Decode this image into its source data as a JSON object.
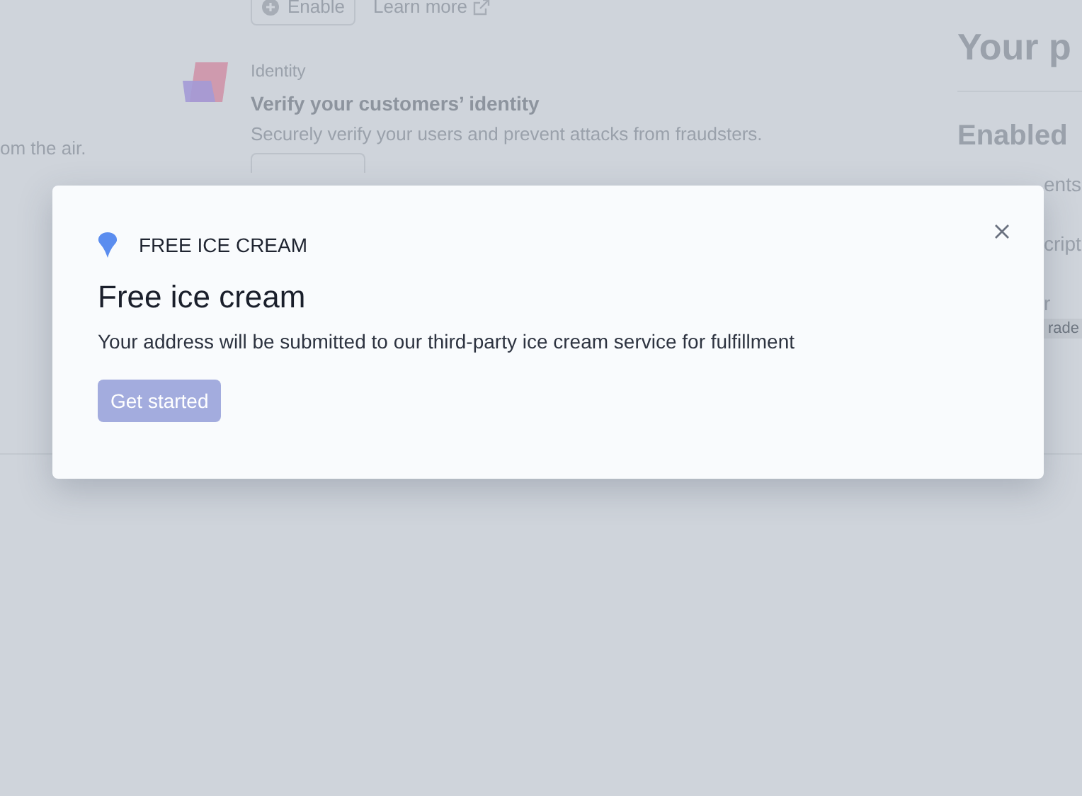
{
  "page": {
    "left_text": "om the air.",
    "enable_button": "Enable",
    "learn_more": "Learn more",
    "identity": {
      "eyebrow": "Identity",
      "title": "Verify your customers’ identity",
      "description": "Securely verify your users and prevent attacks from fraudsters."
    },
    "products": {
      "heading": "Your p",
      "section": "Enabled",
      "items": [
        "ents",
        "cript",
        "r"
      ],
      "badge": "rade"
    }
  },
  "modal": {
    "label": "FREE ICE CREAM",
    "title": "Free ice cream",
    "body": "Your address will be submitted to our third-party ice cream service for fulfillment",
    "button": "Get started"
  }
}
